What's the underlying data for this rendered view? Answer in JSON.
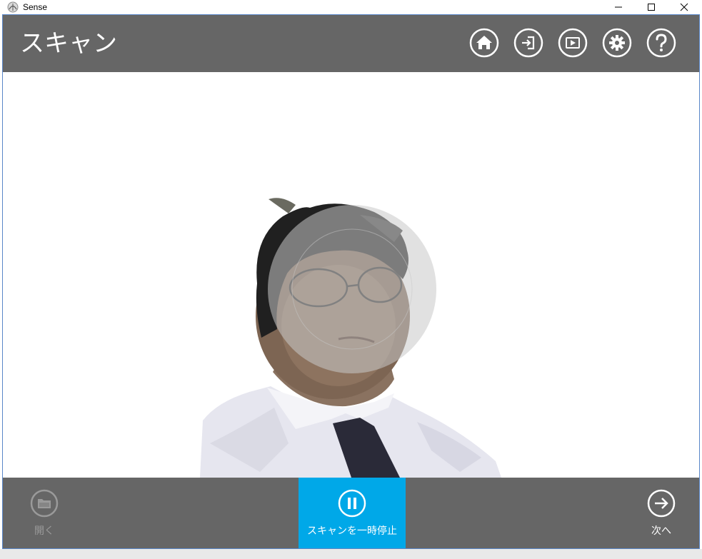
{
  "window": {
    "title": "Sense"
  },
  "header": {
    "title": "スキャン",
    "icons": [
      "home-icon",
      "sign-in-icon",
      "play-icon",
      "gear-icon",
      "help-icon"
    ]
  },
  "bottom": {
    "open_label": "開く",
    "pause_label": "スキャンを一時停止",
    "next_label": "次へ"
  },
  "colors": {
    "bar": "#666666",
    "accent": "#00a8e8",
    "disabled": "#9a9a9a"
  }
}
